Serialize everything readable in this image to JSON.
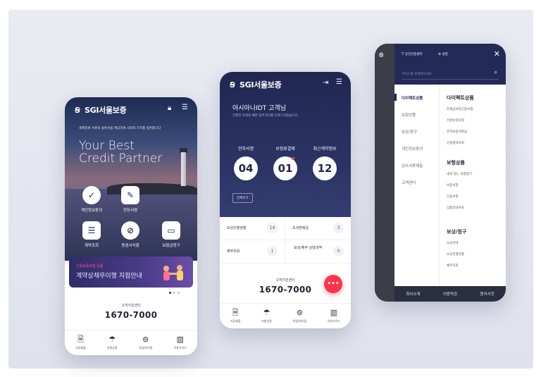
{
  "phone_main": {
    "brand": "SGI서울보증",
    "tagline": "세계일류 수준의 솔루션을 제공하여 사회적 가치를 실현합니다",
    "slogan_line1": "Your Best",
    "slogan_line2": "Credit Partner",
    "quick_menu": [
      {
        "label": "개인정보동의",
        "icon": "check-circle-icon"
      },
      {
        "label": "전자서명",
        "icon": "edit-icon"
      },
      {
        "label": "계약조회",
        "icon": "user-list-icon"
      },
      {
        "label": "증권서식함",
        "icon": "paperclip-icon"
      },
      {
        "label": "보험금청구",
        "icon": "wallet-icon"
      }
    ],
    "banner_tag": "신용보증보험 상품",
    "banner_text": "계약상채무이행 지점안내",
    "customer_center_label": "고객지원센터",
    "customer_center_phone": "1670-7000",
    "bottom_nav": [
      "서류제출",
      "보험상품",
      "지점/대리점",
      "이용가이드"
    ]
  },
  "phone_dashboard": {
    "brand": "SGI서울보증",
    "greeting": "아시아나IDT 고객님",
    "greeting_sub": "간편한 조회와 빠른 업무처리를 도와드리겠습니다.",
    "stats": [
      {
        "label": "전자서명",
        "value": "04"
      },
      {
        "label": "보험료결제",
        "value": "01"
      },
      {
        "label": "최근계약정보",
        "value": "12"
      }
    ],
    "all_view": "전체보기",
    "grid": [
      {
        "label": "보상진행현황",
        "count": "14"
      },
      {
        "label": "초과변제금",
        "count": "3"
      },
      {
        "label": "채무조회",
        "count": "1"
      },
      {
        "label": "보상/채무 상담내역",
        "count": "0"
      }
    ],
    "customer_center_label": "고객지원센터",
    "customer_center_phone": "1670-7000",
    "fab": "•••",
    "bottom_nav": [
      "서류제출",
      "보험상품",
      "지점/대리점",
      "이용가이드"
    ]
  },
  "phone_menu": {
    "top_links": [
      "공인인증센터",
      "설정"
    ],
    "search_placeholder": "서비스를 검색해보세요",
    "categories": [
      "다이렉트상품",
      "보험상품",
      "보상/청구",
      "개인정보동의",
      "심사서류제출",
      "고객센터"
    ],
    "sections": [
      {
        "title": "다이렉트상품",
        "items": [
          "전세금보장신용보험",
          "신원보증보험",
          "전자보증서발급",
          "신청결과조회"
        ]
      },
      {
        "title": "보험상품",
        "items": [
          "내게 맞는 보험찾기",
          "보증보험",
          "신용보험",
          "상품안내자료"
        ]
      },
      {
        "title": "보상/청구",
        "items": [
          "보상안내",
          "보상진행현황",
          "채무조회"
        ]
      }
    ],
    "footer": [
      "회사소개",
      "이용약관",
      "용어사전"
    ]
  }
}
